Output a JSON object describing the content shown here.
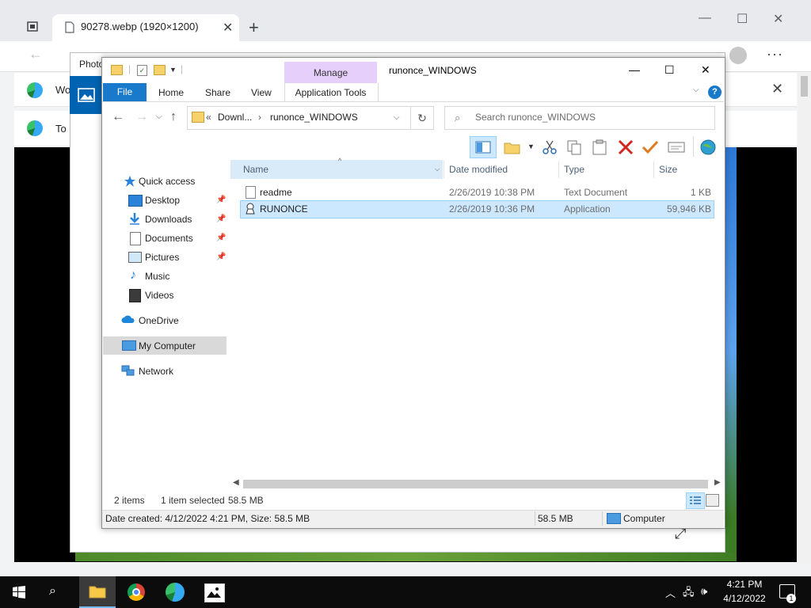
{
  "browser": {
    "tab_title": "90278.webp (1920×1200)",
    "tab_close": "✕",
    "new_tab": "+",
    "minimize": "—",
    "maximize": "☐",
    "close": "✕",
    "back": "←",
    "menu": "···",
    "notification1_text": "Wo",
    "notification2_text": "To",
    "notification_close": "✕"
  },
  "photos": {
    "title": "Photo",
    "resize_icon": "⤢"
  },
  "explorer": {
    "window_title": "runonce_WINDOWS",
    "contextual_tab_group": "Manage",
    "contextual_tab": "Application Tools",
    "ribbon_tabs": [
      "File",
      "Home",
      "Share",
      "View"
    ],
    "address_overflow": "«",
    "address_segments": [
      "Downl...",
      "runonce_WINDOWS"
    ],
    "search_placeholder": "Search runonce_WINDOWS",
    "help": "?",
    "nav_pane": {
      "quick_access": "Quick access",
      "pinned": [
        {
          "label": "Desktop",
          "pinned": true
        },
        {
          "label": "Downloads",
          "pinned": true
        },
        {
          "label": "Documents",
          "pinned": true
        },
        {
          "label": "Pictures",
          "pinned": true
        },
        {
          "label": "Music",
          "pinned": false
        },
        {
          "label": "Videos",
          "pinned": false
        }
      ],
      "onedrive": "OneDrive",
      "my_computer": "My Computer",
      "network": "Network",
      "selected": "My Computer"
    },
    "columns": [
      "Name",
      "Date modified",
      "Type",
      "Size"
    ],
    "files": [
      {
        "name": "readme",
        "date": "2/26/2019 10:38 PM",
        "type": "Text Document",
        "size": "1 KB",
        "selected": false
      },
      {
        "name": "RUNONCE",
        "date": "2/26/2019 10:36 PM",
        "type": "Application",
        "size": "59,946 KB",
        "selected": true
      }
    ],
    "status": {
      "item_count": "2 items",
      "selection": "1 item selected",
      "selection_size": "58.5 MB"
    },
    "details_bar": {
      "info": "Date created: 4/12/2022 4:21 PM, Size: 58.5 MB",
      "size": "58.5 MB",
      "location": "Computer"
    }
  },
  "taskbar": {
    "time": "4:21 PM",
    "date": "4/12/2022",
    "notification_count": "1"
  },
  "colors": {
    "accent": "#1979ca",
    "manage_tab": "#e6cffa",
    "selection": "#cce8ff"
  }
}
